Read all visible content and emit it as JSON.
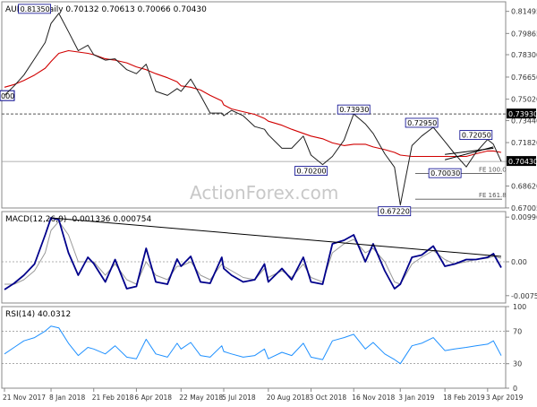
{
  "chart_data": [
    {
      "type": "line",
      "panel": "price",
      "title": "AUDUSD,Daily  0.70132 0.70613 0.70066 0.70430",
      "instrument": "AUDUSD",
      "timeframe": "Daily",
      "quote": {
        "open": 0.70132,
        "high": 0.70613,
        "low": 0.70066,
        "close": 0.7043
      },
      "ylim": [
        0.67,
        0.822
      ],
      "yticks": [
        "0.81495",
        "0.79865",
        "0.78300",
        "0.76650",
        "0.75020",
        "0.73440",
        "0.71820",
        "0.70430",
        "0.68620",
        "0.67005"
      ],
      "current_price_label": "0.70430",
      "current_price": 0.7043,
      "hline_label": "0.73930",
      "hline_value": 0.7393,
      "x": [
        "2017-11-21",
        "2017-12-01",
        "2017-12-11",
        "2017-12-22",
        "2018-01-02",
        "2018-01-08",
        "2018-01-16",
        "2018-01-26",
        "2018-02-05",
        "2018-02-15",
        "2018-02-21",
        "2018-03-05",
        "2018-03-15",
        "2018-03-27",
        "2018-04-06",
        "2018-04-16",
        "2018-04-26",
        "2018-05-08",
        "2018-05-18",
        "2018-05-22",
        "2018-06-01",
        "2018-06-11",
        "2018-06-21",
        "2018-07-03",
        "2018-07-05",
        "2018-07-13",
        "2018-07-25",
        "2018-08-06",
        "2018-08-16",
        "2018-08-20",
        "2018-09-03",
        "2018-09-13",
        "2018-09-25",
        "2018-10-03",
        "2018-10-15",
        "2018-10-25",
        "2018-11-06",
        "2018-11-16",
        "2018-11-28",
        "2018-12-06",
        "2018-12-18",
        "2018-12-28",
        "2019-01-03",
        "2019-01-15",
        "2019-01-25",
        "2019-02-06",
        "2019-02-18",
        "2019-02-28",
        "2019-03-12",
        "2019-03-22",
        "2019-04-03",
        "2019-04-09",
        "2019-04-17"
      ],
      "series": [
        {
          "name": "AUDUSD",
          "color": "#1e1e1e",
          "values": [
            0.753,
            0.76,
            0.768,
            0.78,
            0.792,
            0.806,
            0.8135,
            0.8,
            0.786,
            0.79,
            0.783,
            0.779,
            0.78,
            0.772,
            0.769,
            0.776,
            0.756,
            0.753,
            0.758,
            0.756,
            0.765,
            0.753,
            0.74,
            0.74,
            0.738,
            0.742,
            0.738,
            0.73,
            0.728,
            0.724,
            0.714,
            0.714,
            0.723,
            0.709,
            0.702,
            0.708,
            0.72,
            0.7393,
            0.732,
            0.725,
            0.71,
            0.7,
            0.6722,
            0.716,
            0.723,
            0.7295,
            0.719,
            0.71,
            0.7003,
            0.711,
            0.7205,
            0.717,
            0.7043
          ]
        },
        {
          "name": "",
          "color": "#d10000",
          "values": [
            0.759,
            0.761,
            0.764,
            0.768,
            0.773,
            0.778,
            0.784,
            0.786,
            0.785,
            0.784,
            0.783,
            0.78,
            0.779,
            0.777,
            0.774,
            0.772,
            0.769,
            0.766,
            0.763,
            0.76,
            0.759,
            0.757,
            0.753,
            0.749,
            0.746,
            0.743,
            0.741,
            0.739,
            0.736,
            0.734,
            0.731,
            0.728,
            0.725,
            0.723,
            0.721,
            0.718,
            0.716,
            0.717,
            0.717,
            0.715,
            0.713,
            0.711,
            0.709,
            0.708,
            0.708,
            0.708,
            0.708,
            0.708,
            0.708,
            0.71,
            0.712,
            0.712,
            0.711
          ]
        }
      ],
      "annotations": [
        {
          "label": "0.81350",
          "x": "2017-12-22",
          "y": 0.8135
        },
        {
          "label": "0.73930",
          "x": "2018-11-16",
          "y": 0.7393
        },
        {
          "label": "0.72950",
          "x": "2019-01-25",
          "y": 0.7295
        },
        {
          "label": "0.72050",
          "x": "2019-03-22",
          "y": 0.7205
        },
        {
          "label": "0.70200",
          "x": "2018-10-03",
          "y": 0.702
        },
        {
          "label": "0.70030",
          "x": "2019-02-18",
          "y": 0.7003
        },
        {
          "label": "0.67220",
          "x": "2018-12-28",
          "y": 0.6722
        }
      ],
      "fib_levels": [
        {
          "label": "FE 100.0",
          "value": 0.6955
        },
        {
          "label": "FE 161.8",
          "value": 0.6765
        }
      ],
      "watermark": "ActionForex.com",
      "left_edge_label": "000"
    },
    {
      "type": "line",
      "panel": "macd",
      "title": "MACD(12,26,9) -0.001336 0.000754",
      "ylim": [
        -0.0092,
        0.0112
      ],
      "yticks": [
        "0.009964",
        "0.00",
        "-0.00756"
      ],
      "series": [
        {
          "name": "",
          "color": "#00008b",
          "values": [
            -0.0062,
            -0.0048,
            -0.003,
            -0.0005,
            0.006,
            0.0098,
            0.0094,
            0.002,
            -0.003,
            0.001,
            -0.0004,
            -0.0045,
            0.0005,
            -0.006,
            -0.0055,
            0.003,
            -0.0045,
            -0.005,
            0.0006,
            -0.001,
            0.0012,
            -0.0045,
            -0.0048,
            0.001,
            -0.0015,
            -0.003,
            -0.0045,
            -0.004,
            -0.0005,
            -0.0045,
            -0.0015,
            -0.004,
            0.001,
            -0.0045,
            -0.005,
            0.004,
            0.0048,
            0.006,
            0.0,
            0.004,
            -0.002,
            -0.006,
            -0.005,
            0.001,
            0.0015,
            0.0035,
            -0.001,
            -0.0005,
            0.0005,
            0.0005,
            0.001,
            0.0018,
            -0.0013
          ]
        },
        {
          "name": "",
          "color": "#999999",
          "values": [
            -0.005,
            -0.005,
            -0.004,
            -0.002,
            0.002,
            0.007,
            0.009,
            0.006,
            0.0,
            0.0,
            0.0,
            -0.003,
            -0.0005,
            -0.004,
            -0.005,
            0.0,
            -0.003,
            -0.004,
            -0.001,
            -0.001,
            0.0,
            -0.003,
            -0.004,
            -0.0005,
            -0.001,
            -0.002,
            -0.0035,
            -0.004,
            -0.0015,
            -0.0035,
            -0.002,
            -0.0035,
            -0.0005,
            -0.0035,
            -0.0045,
            0.002,
            0.004,
            0.005,
            0.002,
            0.003,
            0.0,
            -0.0045,
            -0.005,
            -0.0005,
            0.001,
            0.0025,
            0.0005,
            -0.0005,
            0.0,
            0.0005,
            0.0008,
            0.0012,
            0.0008
          ]
        }
      ],
      "trendline": {
        "from": {
          "x": "2018-01-08",
          "y": 0.0098
        },
        "to": {
          "x": "2019-04-17",
          "y": 0.0012
        }
      }
    },
    {
      "type": "line",
      "panel": "rsi",
      "title": "RSI(14) 40.0312",
      "ylim": [
        0,
        100
      ],
      "yticks": [
        "100",
        "70",
        "30",
        "0"
      ],
      "levels": [
        70,
        30
      ],
      "series": [
        {
          "name": "",
          "color": "#1e90ff",
          "values": [
            42,
            50,
            58,
            62,
            70,
            76,
            74,
            55,
            40,
            50,
            48,
            42,
            52,
            38,
            36,
            60,
            42,
            38,
            55,
            48,
            56,
            40,
            38,
            52,
            45,
            42,
            38,
            40,
            48,
            36,
            44,
            40,
            55,
            38,
            35,
            58,
            62,
            66,
            48,
            56,
            42,
            35,
            30,
            52,
            55,
            62,
            46,
            48,
            50,
            52,
            54,
            58,
            40
          ]
        }
      ]
    }
  ],
  "xaxis": {
    "tick_labels": [
      "21 Nov 2017",
      "8 Jan 2018",
      "21 Feb 2018",
      "6 Apr 2018",
      "22 May 2018",
      "5 Jul 2018",
      "20 Aug 2018",
      "3 Oct 2018",
      "16 Nov 2018",
      "3 Jan 2019",
      "18 Feb 2019",
      "3 Apr 2019"
    ],
    "tick_dates": [
      "2017-11-21",
      "2018-01-08",
      "2018-02-21",
      "2018-04-06",
      "2018-05-22",
      "2018-07-05",
      "2018-08-20",
      "2018-10-03",
      "2018-11-16",
      "2019-01-03",
      "2019-02-18",
      "2019-04-03"
    ]
  },
  "colors": {
    "price": "#1e1e1e",
    "sma": "#d10000",
    "macd": "#00008b",
    "signal": "#999999",
    "rsi": "#1e90ff",
    "label_box_border": "#00008b",
    "current_label_bg": "#000000"
  }
}
